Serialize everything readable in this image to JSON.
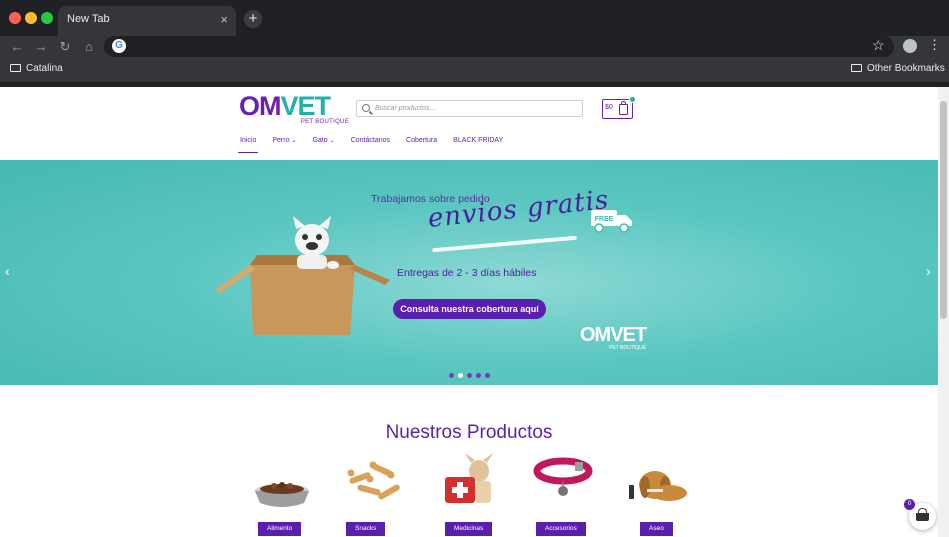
{
  "browser": {
    "tab_title": "New Tab",
    "tab_close": "×",
    "new_tab": "+",
    "address": "",
    "bookmark_left": "Catalina",
    "bookmark_right": "Other Bookmarks"
  },
  "site": {
    "logo_main_om": "OM",
    "logo_main_vet": "VET",
    "logo_sub": "PET BOUTIQUE",
    "search_placeholder": "Buscar productos...",
    "cart_amount": "$0",
    "nav": [
      "Inicio",
      "Perro",
      "Gato",
      "Contáctanos",
      "Cobertura",
      "BLACK FRIDAY"
    ],
    "colors": {
      "primary": "#6a1fb3",
      "accent": "#1fb2a8",
      "hero": "#5cc7c1"
    }
  },
  "hero": {
    "line1": "Trabajamos sobre pedido",
    "script": "envios gratis",
    "free_badge": "FREE",
    "line2": "Entregas de 2 - 3 días hábiles",
    "cta": "Consulta nuestra cobertura aquí",
    "logo_main": "OMVET",
    "logo_sub": "PET BOUTIQUE",
    "prev": "‹",
    "next": "›",
    "slide_count": 5,
    "active_slide": 2
  },
  "products": {
    "title": "Nuestros Productos",
    "items": [
      {
        "label": "Alimento",
        "icon": "dog-food-bowl-icon"
      },
      {
        "label": "Snacks",
        "icon": "dog-biscuit-icon"
      },
      {
        "label": "Medicinas",
        "icon": "first-aid-dog-icon"
      },
      {
        "label": "Accesorios",
        "icon": "collar-icon"
      },
      {
        "label": "Aseo",
        "icon": "grooming-dog-icon"
      }
    ]
  },
  "floating_cart": {
    "count": "0"
  }
}
